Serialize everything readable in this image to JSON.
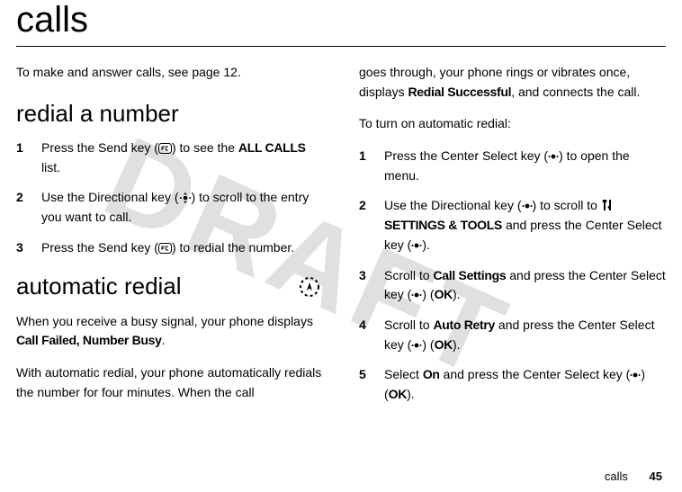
{
  "watermark": "DRAFT",
  "title": "calls",
  "intro": "To make and answer calls, see page 12.",
  "sections": {
    "redial": {
      "heading": "redial a number",
      "steps": [
        {
          "n": "1",
          "pre": "Press the Send key (",
          "post": ") to see the ",
          "bold": "ALL CALLS",
          "tail": " list."
        },
        {
          "n": "2",
          "pre": "Use the Directional key (",
          "post": ") to scroll to the entry you want to call."
        },
        {
          "n": "3",
          "pre": "Press the Send key (",
          "post": ") to redial the number."
        }
      ]
    },
    "auto": {
      "heading": "automatic redial",
      "p1a": "When you receive a busy signal, your phone displays ",
      "p1b": "Call Failed, Number Busy",
      "p1c": ".",
      "p2": "With automatic redial, your phone automatically redials the number for four minutes. When the call",
      "p3a": "goes through, your phone rings or vibrates once, displays ",
      "p3b": "Redial Successful",
      "p3c": ", and connects the call.",
      "p4": "To turn on automatic redial:",
      "steps": [
        {
          "n": "1",
          "pre": "Press the Center Select key (",
          "post": ") to open the menu."
        },
        {
          "n": "2",
          "preA": "Use the Directional key (",
          "preB": ") to scroll to ",
          "bold": "SETTINGS & TOOLS",
          "mid": " and press the Center Select key (",
          "post": ")."
        },
        {
          "n": "3",
          "pre": "Scroll to ",
          "bold": "Call Settings",
          "mid": " and press the Center Select key (",
          "post": ") (",
          "ok": "OK",
          "tail": ")."
        },
        {
          "n": "4",
          "pre": "Scroll to ",
          "bold": "Auto Retry",
          "mid": " and press the Center Select key (",
          "post": ") (",
          "ok": "OK",
          "tail": ")."
        },
        {
          "n": "5",
          "pre": "Select ",
          "bold": "On",
          "mid": " and press the Center Select key (",
          "post": ") (",
          "ok": "OK",
          "tail": ")."
        }
      ]
    }
  },
  "footer": {
    "label": "calls",
    "page": "45"
  }
}
